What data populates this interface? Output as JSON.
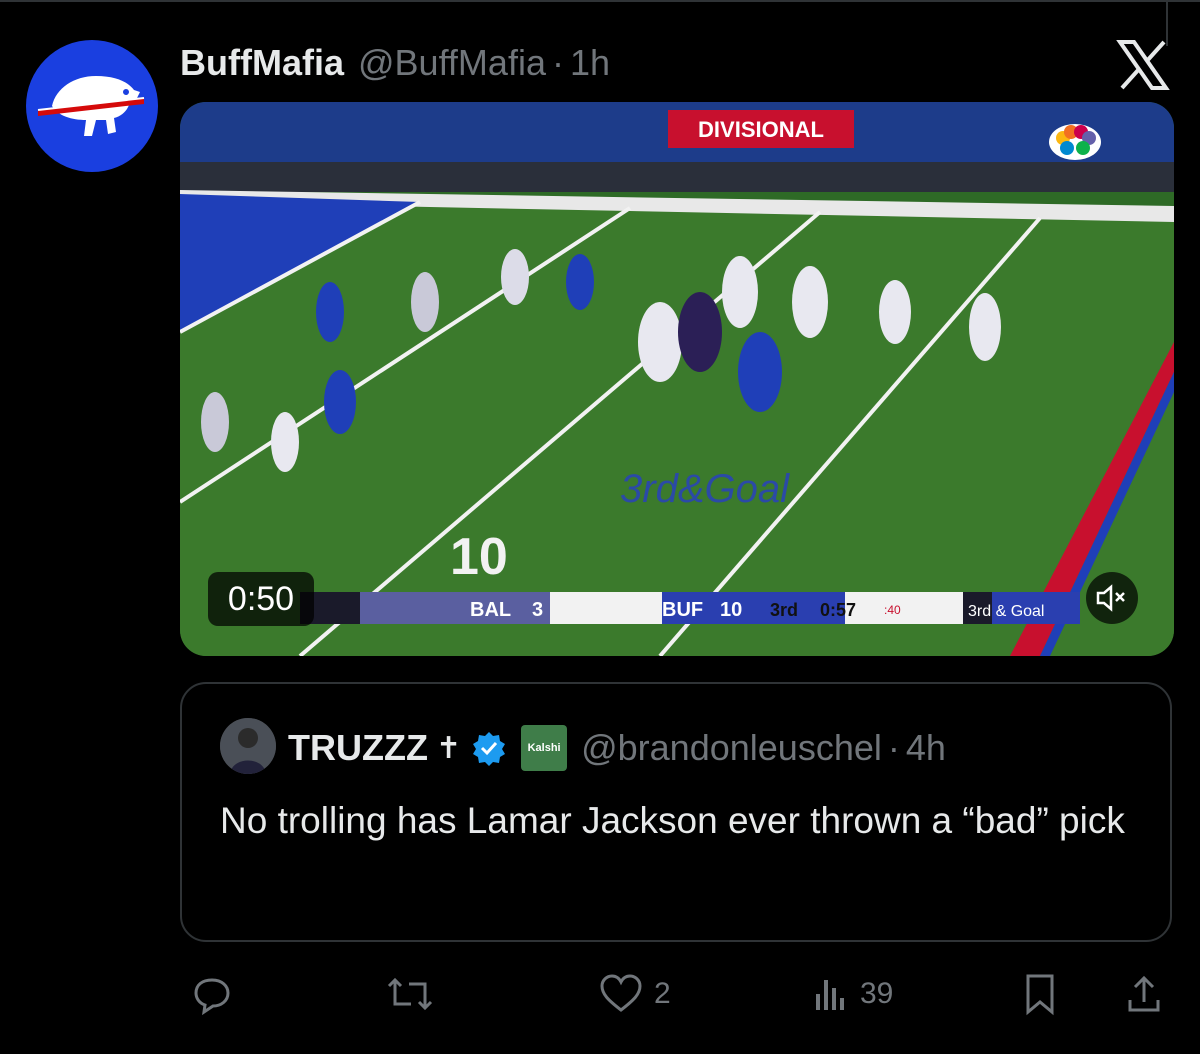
{
  "tweet": {
    "author_name": "BuffMafia",
    "author_handle": "@BuffMafia",
    "separator": "·",
    "time": "1h",
    "video": {
      "duration": "0:50",
      "field_text": "3rd&Goal",
      "yard_10": "10",
      "banner": "DIVISIONAL",
      "score_bug": {
        "team1": "BAL",
        "score1": "3",
        "team2": "BUF",
        "score2": "10",
        "quarter": "3rd",
        "clock": "0:57",
        "play_clock": ":40",
        "down": "3rd & Goal"
      }
    }
  },
  "quoted": {
    "author_name": "TRUZZZ",
    "cross": "✝",
    "badge": "Kalshi",
    "author_handle": "@brandonleuschel",
    "separator": "·",
    "time": "4h",
    "text": "No trolling has Lamar Jackson ever thrown a “bad” pick"
  },
  "actions": {
    "reply_count": "",
    "retweet_count": "",
    "like_count": "2",
    "views_count": "39"
  },
  "icons": [
    "bills-logo-avatar",
    "x-logo-icon",
    "mute-icon",
    "verified-icon",
    "reply-icon",
    "retweet-icon",
    "like-icon",
    "views-icon",
    "bookmark-icon",
    "share-icon"
  ],
  "colors": {
    "background": "#000000",
    "text": "#e7e9ea",
    "secondary": "#71767b",
    "border": "#2f3336",
    "verified": "#1d9bf0",
    "avatar": "#1a3fe0"
  }
}
